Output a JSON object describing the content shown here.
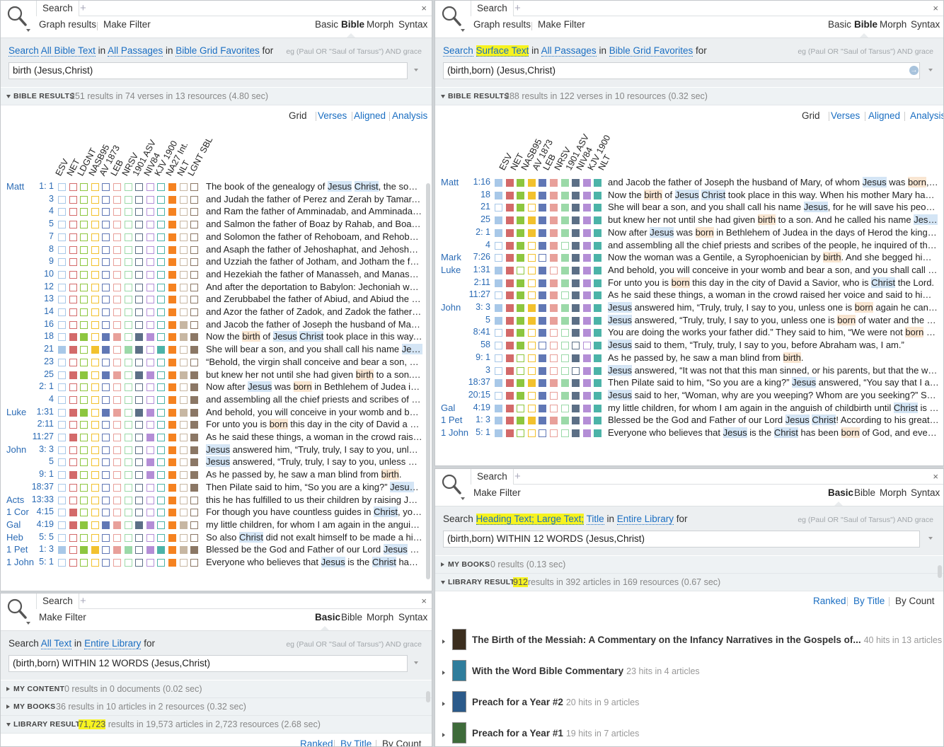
{
  "colors": {
    "link": "#1a6ec2",
    "highlight": "#f7f31f",
    "header_bg": "#eef2f4",
    "search_bg": "#eceff1"
  },
  "p1": {
    "tab": "Search",
    "toolbar": {
      "graph": "Graph results",
      "filter": "Make Filter"
    },
    "types": [
      "Basic",
      "Bible",
      "Morph",
      "Syntax"
    ],
    "selected_type": "Bible",
    "search": {
      "w1": "Search",
      "all": "All Bible Text",
      "w2": "in",
      "passages": "All Passages",
      "w3": "in",
      "grid": "Bible Grid Favorites",
      "w4": "for",
      "eg": "eg (Paul OR \"Saul of Tarsus\") AND grace",
      "query": "birth (Jesus,Christ)"
    },
    "results": {
      "label": "BIBLE RESULTS",
      "summary": "251 results in 74 verses in 13 resources (4.80 sec)"
    },
    "views": [
      "Grid",
      "Verses",
      "Aligned",
      "Analysis"
    ],
    "columns": [
      "ESV",
      "NET",
      "LDGNT",
      "NASB95",
      "AV 1873",
      "LEB",
      "NRSV",
      "1901 ASV",
      "NIV84",
      "KJV 1900",
      "NA27 Int.",
      "NLT",
      "LGNT SBL"
    ],
    "rows": [
      {
        "book": "Matt",
        "ref": "1:  1",
        "text": "The book of the genealogy of Jesus Christ, the son of..."
      },
      {
        "book": "",
        "ref": "3",
        "text": "and Judah the father of Perez and Zerah by Tamar, an..."
      },
      {
        "book": "",
        "ref": "4",
        "text": "and Ram the father of Amminadab, and Amminadab t..."
      },
      {
        "book": "",
        "ref": "5",
        "text": "and Salmon the father of Boaz by Rahab, and Boaz th..."
      },
      {
        "book": "",
        "ref": "7",
        "text": "and Solomon the father of Rehoboam, and Rehoboa..."
      },
      {
        "book": "",
        "ref": "8",
        "text": "and Asaph the father of Jehoshaphat, and Jehoshaph..."
      },
      {
        "book": "",
        "ref": "9",
        "text": "and Uzziah the father of Jotham, and Jotham the fat..."
      },
      {
        "book": "",
        "ref": "10",
        "text": "and Hezekiah the father of Manasseh, and Manasseh..."
      },
      {
        "book": "",
        "ref": "12",
        "text": "And after the deportation to Babylon: Jechoniah was..."
      },
      {
        "book": "",
        "ref": "13",
        "text": "and Zerubbabel the father of Abiud, and Abiud the fa..."
      },
      {
        "book": "",
        "ref": "14",
        "text": "and Azor the father of Zadok, and Zadok the father o..."
      },
      {
        "book": "",
        "ref": "16",
        "text": "and Jacob the father of Joseph the husband of Mary,..."
      },
      {
        "book": "",
        "ref": "18",
        "text": "Now the birth of Jesus Christ took place in this way...."
      },
      {
        "book": "",
        "ref": "21",
        "text": "She will bear a son, and you shall call his name Jesus,..."
      },
      {
        "book": "",
        "ref": "23",
        "text": "“Behold, the virgin shall conceive and bear a son, and..."
      },
      {
        "book": "",
        "ref": "25",
        "text": "but knew her not until she had given birth to a son. A..."
      },
      {
        "book": "",
        "ref": "2:  1",
        "text": "Now after Jesus was born in Bethlehem of Judea in t..."
      },
      {
        "book": "",
        "ref": "4",
        "text": "and assembling all the chief priests and scribes of the..."
      },
      {
        "book": "Luke",
        "ref": "1:31",
        "text": "And behold, you will conceive in your womb and bear..."
      },
      {
        "book": "",
        "ref": "2:11",
        "text": "For unto you is born this day in the city of David a Sav..."
      },
      {
        "book": "",
        "ref": "11:27",
        "text": "As he said these things, a woman in the crowd raised..."
      },
      {
        "book": "John",
        "ref": "3:  3",
        "text": "Jesus answered him, “Truly, truly, I say to you, unless..."
      },
      {
        "book": "",
        "ref": "5",
        "text": "Jesus answered, “Truly, truly, I say to you, unless one..."
      },
      {
        "book": "",
        "ref": "9:  1",
        "text": "As he passed by, he saw a man blind from birth."
      },
      {
        "book": "",
        "ref": "18:37",
        "text": "Then Pilate said to him, “So you are a king?” Jesus an..."
      },
      {
        "book": "Acts",
        "ref": "13:33",
        "text": "this he has fulfilled to us their children by raising Jesu..."
      },
      {
        "book": "1 Cor",
        "ref": "4:15",
        "text": "For though you have countless guides in Christ, you d..."
      },
      {
        "book": "Gal",
        "ref": "4:19",
        "text": "my little children, for whom I am again in the anguish..."
      },
      {
        "book": "Heb",
        "ref": "5:  5",
        "text": "So also Christ did not exalt himself to be made a high..."
      },
      {
        "book": "1 Pet",
        "ref": "1:  3",
        "text": "Blessed be the God and Father of our Lord Jesus Chri..."
      },
      {
        "book": "1 John",
        "ref": "5:  1",
        "text": "Everyone who believes that Jesus is the Christ has be..."
      }
    ]
  },
  "p2": {
    "tab": "Search",
    "toolbar": {
      "graph": "Graph results",
      "filter": "Make Filter"
    },
    "types": [
      "Basic",
      "Bible",
      "Morph",
      "Syntax"
    ],
    "selected_type": "Bible",
    "search": {
      "w1": "Search",
      "all": "Surface Text",
      "w2": "in",
      "passages": "All Passages",
      "w3": "in",
      "grid": "Bible Grid Favorites",
      "w4": "for",
      "eg": "eg (Paul OR \"Saul of Tarsus\") AND grace",
      "query": "(birth,born) (Jesus,Christ)"
    },
    "results": {
      "label": "BIBLE RESULTS",
      "summary": "288 results in 122 verses in 10 resources (0.32 sec)"
    },
    "views": [
      "Grid",
      "Verses",
      "Aligned",
      "Analysis"
    ],
    "columns": [
      "ESV",
      "NET",
      "NASB95",
      "AV 1873",
      "LEB",
      "NRSV",
      "1901 ASV",
      "NIV84",
      "KJV 1900",
      "NLT"
    ],
    "rows": [
      {
        "book": "Matt",
        "ref": "1:16",
        "text": "and Jacob the father of Joseph the husband of Mary, of whom Jesus was born, who i..."
      },
      {
        "book": "",
        "ref": "18",
        "text": "Now the birth of Jesus Christ took place in this way. When his mother Mary had been..."
      },
      {
        "book": "",
        "ref": "21",
        "text": "She will bear a son, and you shall call his name Jesus, for he will save his people from..."
      },
      {
        "book": "",
        "ref": "25",
        "text": "but knew her not until she had given birth to a son. And he called his name Jesus."
      },
      {
        "book": "",
        "ref": "2:  1",
        "text": "Now after Jesus was born in Bethlehem of Judea in the days of Herod the king, behol..."
      },
      {
        "book": "",
        "ref": "4",
        "text": "and assembling all the chief priests and scribes of the people, he inquired of them w..."
      },
      {
        "book": "Mark",
        "ref": "7:26",
        "text": "Now the woman was a Gentile, a Syrophoenician by birth. And she begged him to cas..."
      },
      {
        "book": "Luke",
        "ref": "1:31",
        "text": "And behold, you will conceive in your womb and bear a son, and you shall call his na..."
      },
      {
        "book": "",
        "ref": "2:11",
        "text": "For unto you is born this day in the city of David a Savior, who is Christ the Lord."
      },
      {
        "book": "",
        "ref": "11:27",
        "text": "As he said these things, a woman in the crowd raised her voice and said to him, “Bles..."
      },
      {
        "book": "John",
        "ref": "3:  3",
        "text": "Jesus answered him, “Truly, truly, I say to you, unless one is born again he cannot see..."
      },
      {
        "book": "",
        "ref": "5",
        "text": "Jesus answered, “Truly, truly, I say to you, unless one is born of water and the Spirit,..."
      },
      {
        "book": "",
        "ref": "8:41",
        "text": "You are doing the works your father did.” They said to him, “We were not born of sex..."
      },
      {
        "book": "",
        "ref": "58",
        "text": "Jesus said to them, “Truly, truly, I say to you, before Abraham was, I am.”"
      },
      {
        "book": "",
        "ref": "9:  1",
        "text": "As he passed by, he saw a man blind from birth."
      },
      {
        "book": "",
        "ref": "3",
        "text": "Jesus answered, “It was not that this man sinned, or his parents, but that the works..."
      },
      {
        "book": "",
        "ref": "18:37",
        "text": "Then Pilate said to him, “So you are a king?” Jesus answered, “You say that I am a kin..."
      },
      {
        "book": "",
        "ref": "20:15",
        "text": "Jesus said to her, “Woman, why are you weeping? Whom are you seeking?” Supposin..."
      },
      {
        "book": "Gal",
        "ref": "4:19",
        "text": "my little children, for whom I am again in the anguish of childbirth until Christ is form..."
      },
      {
        "book": "1 Pet",
        "ref": "1:  3",
        "text": "Blessed be the God and Father of our Lord Jesus Christ! According to his great mercy..."
      },
      {
        "book": "1 John",
        "ref": "5:  1",
        "text": "Everyone who believes that Jesus is the Christ has been born of God, and everyone..."
      }
    ]
  },
  "p3": {
    "tab": "Search",
    "toolbar": {
      "filter": "Make Filter"
    },
    "types": [
      "Basic",
      "Bible",
      "Morph",
      "Syntax"
    ],
    "selected_type": "Basic",
    "search": {
      "w1": "Search",
      "all": "All Text",
      "w2": "in",
      "lib": "Entire Library",
      "w3": "for",
      "eg": "eg (Paul OR \"Saul of Tarsus\") AND grace",
      "query": "(birth,born) WITHIN 12 WORDS (Jesus,Christ)"
    },
    "sections": [
      {
        "label": "MY CONTENT",
        "summary": "0 results in 0 documents (0.02 sec)"
      },
      {
        "label": "MY BOOKS",
        "summary": "36 results in 10 articles in 2 resources (0.32 sec)"
      },
      {
        "label": "LIBRARY RESULTS",
        "count": "71,723",
        "summary": "results in 19,573 articles in 2,723 resources (2.68 sec)"
      }
    ],
    "views": [
      "Ranked",
      "By Title",
      "By Count"
    ]
  },
  "p4": {
    "tab": "Search",
    "toolbar": {
      "filter": "Make Filter"
    },
    "types": [
      "Basic",
      "Bible",
      "Morph",
      "Syntax"
    ],
    "selected_type": "Basic",
    "search": {
      "w1": "Search",
      "h1": "Heading Text; Large Text;",
      "h2": "Title",
      "w2": "in",
      "lib": "Entire Library",
      "w3": "for",
      "eg": "eg (Paul OR \"Saul of Tarsus\") AND grace",
      "query": "(birth,born) WITHIN 12 WORDS (Jesus,Christ)"
    },
    "sections": [
      {
        "label": "MY BOOKS",
        "summary": "0 results (0.13 sec)"
      },
      {
        "label": "LIBRARY RESULTS",
        "count": "912",
        "summary": "results in 392 articles in 169 resources (0.67 sec)"
      }
    ],
    "views": [
      "Ranked",
      "By Title",
      "By Count"
    ],
    "items": [
      {
        "title": "The Birth of the Messiah: A Commentary on the Infancy Narratives in the Gospels of...",
        "count": "40 hits in 13 articles"
      },
      {
        "title": "With the Word Bible Commentary",
        "count": "23 hits in 4 articles"
      },
      {
        "title": "Preach for a Year #2",
        "count": "20 hits in 9 articles"
      },
      {
        "title": "Preach for a Year #1",
        "count": "19 hits in 7 articles"
      }
    ]
  }
}
